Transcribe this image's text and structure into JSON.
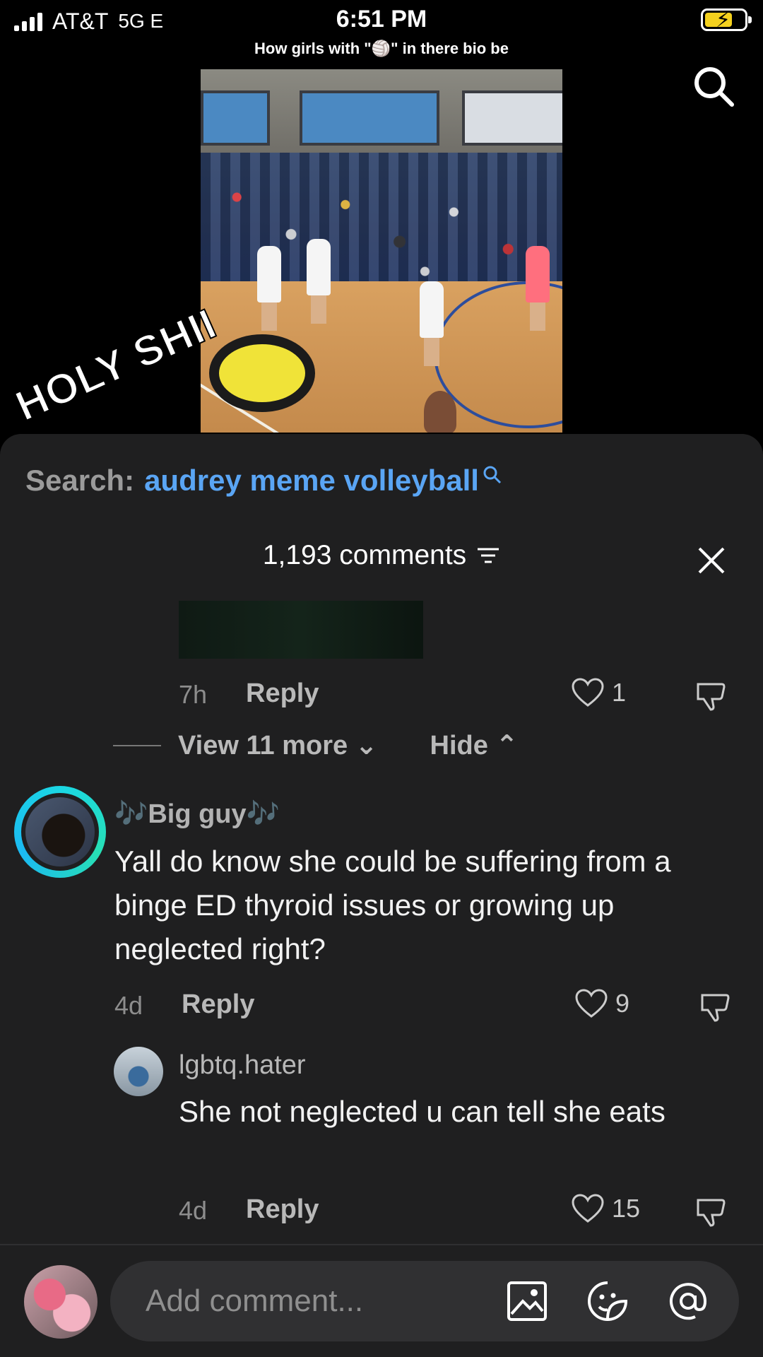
{
  "status": {
    "carrier": "AT&T",
    "network": "5G E",
    "time": "6:51 PM"
  },
  "video": {
    "caption": "How girls with \"🏐\" in there bio be",
    "overlay_text": "HOLY SHII"
  },
  "search": {
    "label": "Search:",
    "query": "audrey meme volleyball"
  },
  "comments_header": {
    "count": "1,193 comments"
  },
  "prev_comment": {
    "time": "7h",
    "reply": "Reply",
    "likes": "1"
  },
  "thread": {
    "view_more": "View 11 more",
    "hide": "Hide"
  },
  "comments": [
    {
      "author": "🎶Big guy🎶",
      "text": "Yall do know she could be suffering from a binge ED thyroid issues or growing up neglected right?",
      "time": "4d",
      "reply": "Reply",
      "likes": "9"
    },
    {
      "author": "lgbtq.hater",
      "text": "She not neglected u can tell she eats",
      "time": "4d",
      "reply": "Reply",
      "likes": "15"
    }
  ],
  "composer": {
    "placeholder": "Add comment..."
  },
  "colors": {
    "accent_link": "#5aa5f4",
    "panel_bg": "#1f1f20",
    "battery": "#f4d11e"
  }
}
